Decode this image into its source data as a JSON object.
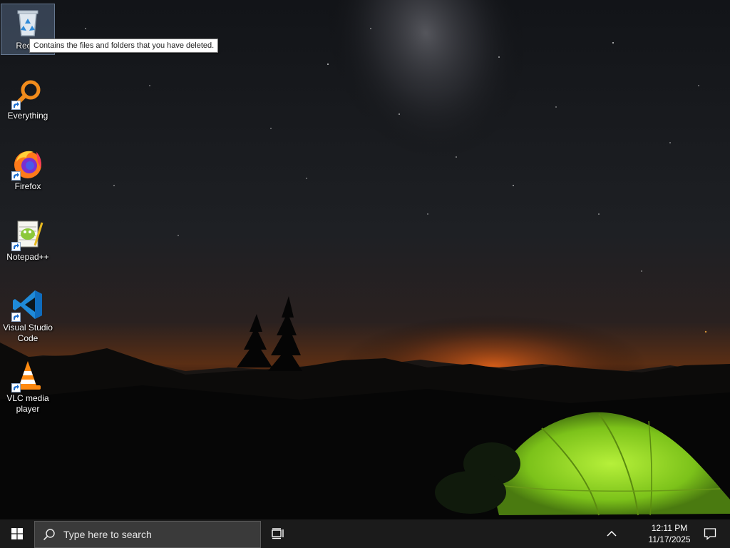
{
  "desktop": {
    "icons": [
      {
        "label": "Recycle Bin",
        "visible_label": "Recyc",
        "icon": "recycle-bin-icon",
        "selected": true
      },
      {
        "label": "Everything",
        "icon": "everything-search-icon"
      },
      {
        "label": "Firefox",
        "icon": "firefox-icon"
      },
      {
        "label": "Notepad++",
        "icon": "notepad-plus-plus-icon"
      },
      {
        "label": "Visual Studio Code",
        "line1": "Visual Studio",
        "line2": "Code",
        "icon": "vscode-icon"
      },
      {
        "label": "VLC media player",
        "line1": "VLC media",
        "line2": "player",
        "icon": "vlc-icon"
      }
    ],
    "tooltip": "Contains the files and folders that you have deleted."
  },
  "taskbar": {
    "start_icon": "windows-logo-icon",
    "search_placeholder": "Type here to search",
    "taskview_icon": "task-view-icon",
    "tray_chevron_icon": "chevron-up-icon",
    "time": "12:11 PM",
    "date": "11/17/2025",
    "notification_icon": "action-center-icon"
  },
  "colors": {
    "taskbar_bg": "#1b1b1b",
    "search_bg": "#3a3a3a",
    "tent_green": "#9be22a",
    "horizon_orange": "#d86a1c"
  }
}
